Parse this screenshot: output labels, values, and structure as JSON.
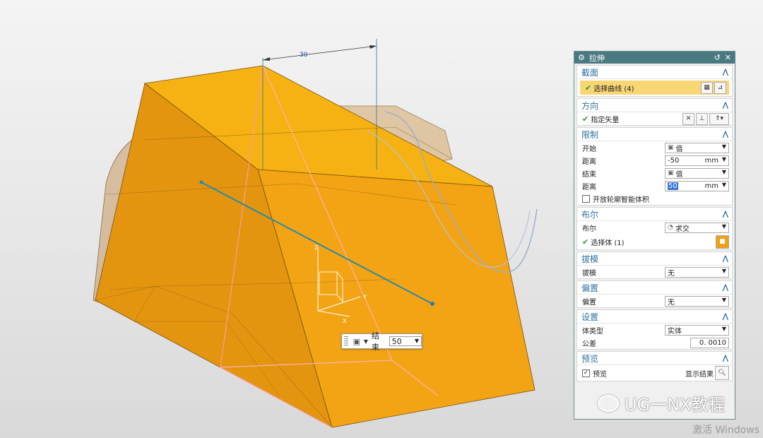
{
  "viewport": {
    "dimension_label": "30",
    "axis_z": "Z",
    "axis_y": "Y",
    "axis_x": "X"
  },
  "mini_toolbar": {
    "end_label": "结束",
    "end_value": "50"
  },
  "dialog": {
    "title": "拉伸",
    "sections": {
      "section": {
        "header": "截面",
        "select_curve": "选择曲线 (4)"
      },
      "direction": {
        "header": "方向",
        "specify_vector": "指定矢量"
      },
      "limits": {
        "header": "限制",
        "start_label": "开始",
        "start_value": "值",
        "distance1_label": "距离",
        "distance1_value": "-50",
        "distance1_unit": "mm",
        "end_label": "结束",
        "end_value": "值",
        "distance2_label": "距离",
        "distance2_value": "50",
        "distance2_unit": "mm",
        "open_profile_label": "开放轮廓智能体积"
      },
      "boolean": {
        "header": "布尔",
        "boolean_label": "布尔",
        "boolean_value": "求交",
        "select_body": "选择体 (1)"
      },
      "draft": {
        "header": "拔模",
        "draft_label": "拔模",
        "draft_value": "无"
      },
      "offset": {
        "header": "偏置",
        "offset_label": "偏置",
        "offset_value": "无"
      },
      "settings": {
        "header": "设置",
        "body_type_label": "体类型",
        "body_type_value": "实体",
        "tolerance_label": "公差",
        "tolerance_value": "0. 0010"
      },
      "preview": {
        "header": "预览",
        "preview_label": "预览",
        "show_result_label": "显示结果"
      }
    }
  },
  "watermark": {
    "text": "UG一NX教程"
  },
  "activate_windows": "激活 Windows",
  "colors": {
    "solid_orange": "#f0a015",
    "title_bar": "#4a7a80",
    "section_header": "#2f6fa0",
    "selection_highlight": "#f9d674"
  }
}
